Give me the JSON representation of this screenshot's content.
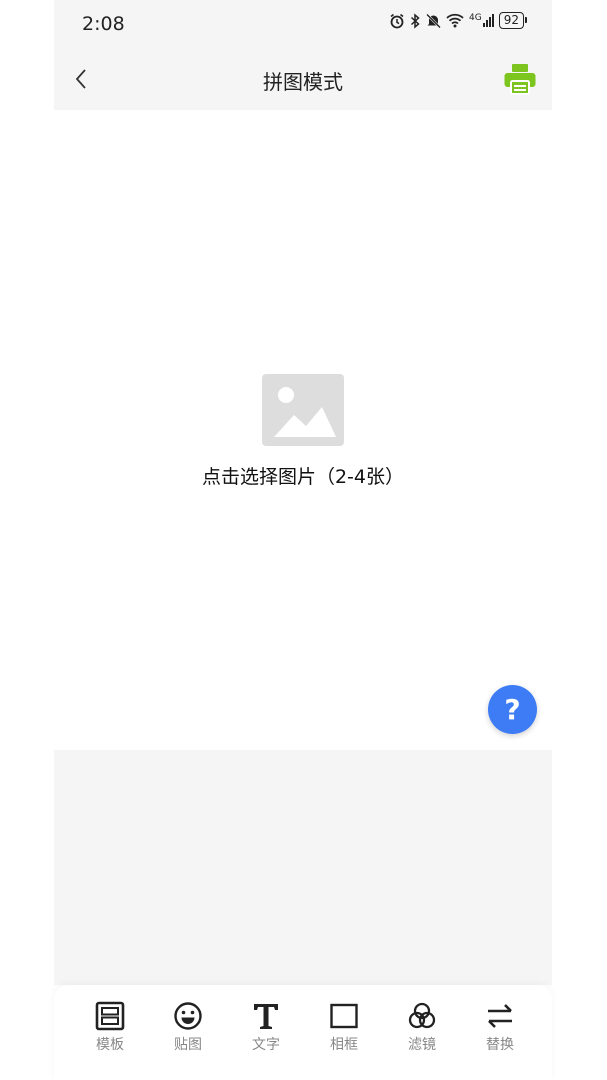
{
  "status_bar": {
    "time": "2:08",
    "icons": [
      "alarm-icon",
      "bluetooth-icon",
      "mute-icon",
      "wifi-icon",
      "signal-4g-icon"
    ],
    "network_label": "4G",
    "battery": "92"
  },
  "nav": {
    "title": "拼图模式",
    "back_icon": "back-chevron-icon",
    "print_icon": "printer-icon",
    "accent_color": "#7cc41e"
  },
  "canvas": {
    "placeholder_text": "点击选择图片（2-4张）",
    "placeholder_icon": "image-placeholder-icon",
    "help_label": "?",
    "help_color": "#3d7cf4"
  },
  "toolbar": {
    "items": [
      {
        "label": "模板",
        "icon": "template-icon"
      },
      {
        "label": "贴图",
        "icon": "sticker-icon"
      },
      {
        "label": "文字",
        "icon": "text-icon"
      },
      {
        "label": "相框",
        "icon": "frame-icon"
      },
      {
        "label": "滤镜",
        "icon": "filter-icon"
      },
      {
        "label": "替换",
        "icon": "swap-icon"
      }
    ]
  }
}
